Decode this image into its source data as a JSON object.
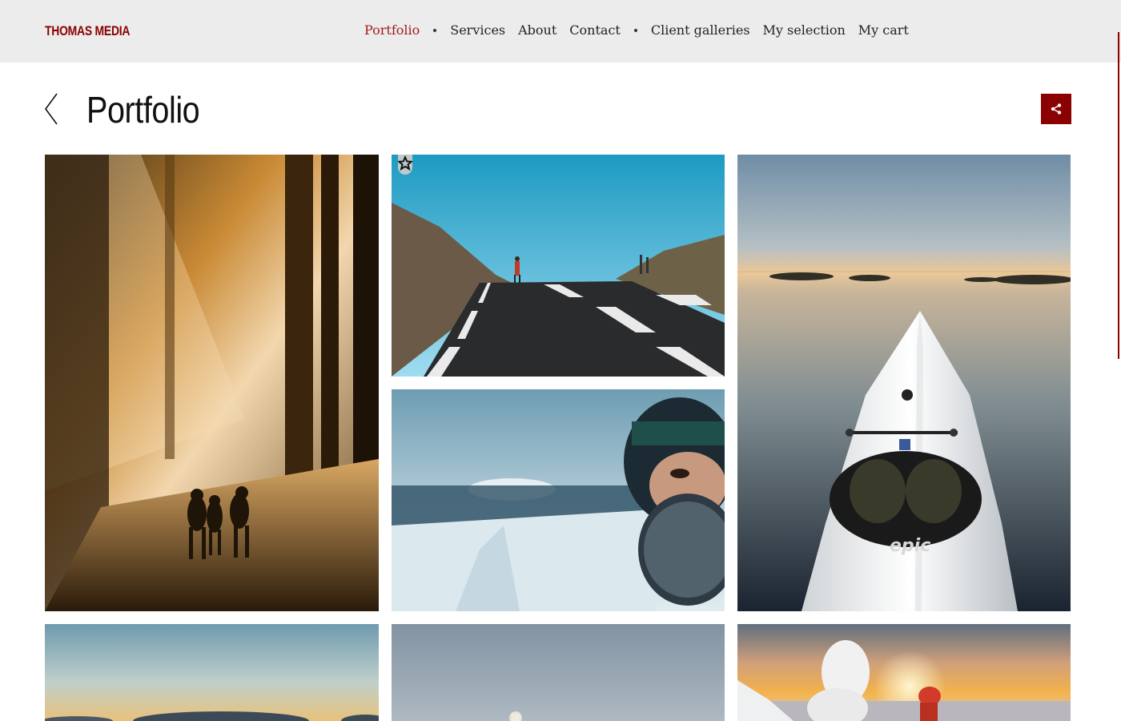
{
  "brand": {
    "name": "THOMAS MEDIA"
  },
  "nav": {
    "items": [
      {
        "label": "Portfolio",
        "active": true
      },
      {
        "label": "Services"
      },
      {
        "label": "About"
      },
      {
        "label": "Contact"
      },
      {
        "label": "Client galleries"
      },
      {
        "label": "My selection"
      },
      {
        "label": "My cart"
      }
    ]
  },
  "page": {
    "title": "Portfolio"
  },
  "icons": {
    "back": "chevron-left-icon",
    "share": "share-icon",
    "favorite": "star-icon"
  },
  "colors": {
    "accent": "#8b0000",
    "header_bg": "#ececec",
    "text": "#111111"
  },
  "gallery": {
    "photos": [
      {
        "subject": "forest-runners-sunbeams"
      },
      {
        "subject": "runner-on-road-blue-sky",
        "favorite": true
      },
      {
        "subject": "kayak-bow-calm-lake"
      },
      {
        "subject": "frosted-face-winter-landscape"
      },
      {
        "subject": "hill-sunset"
      },
      {
        "subject": "snowy-hilltop"
      },
      {
        "subject": "snow-trees-sunset-hiker"
      }
    ]
  }
}
